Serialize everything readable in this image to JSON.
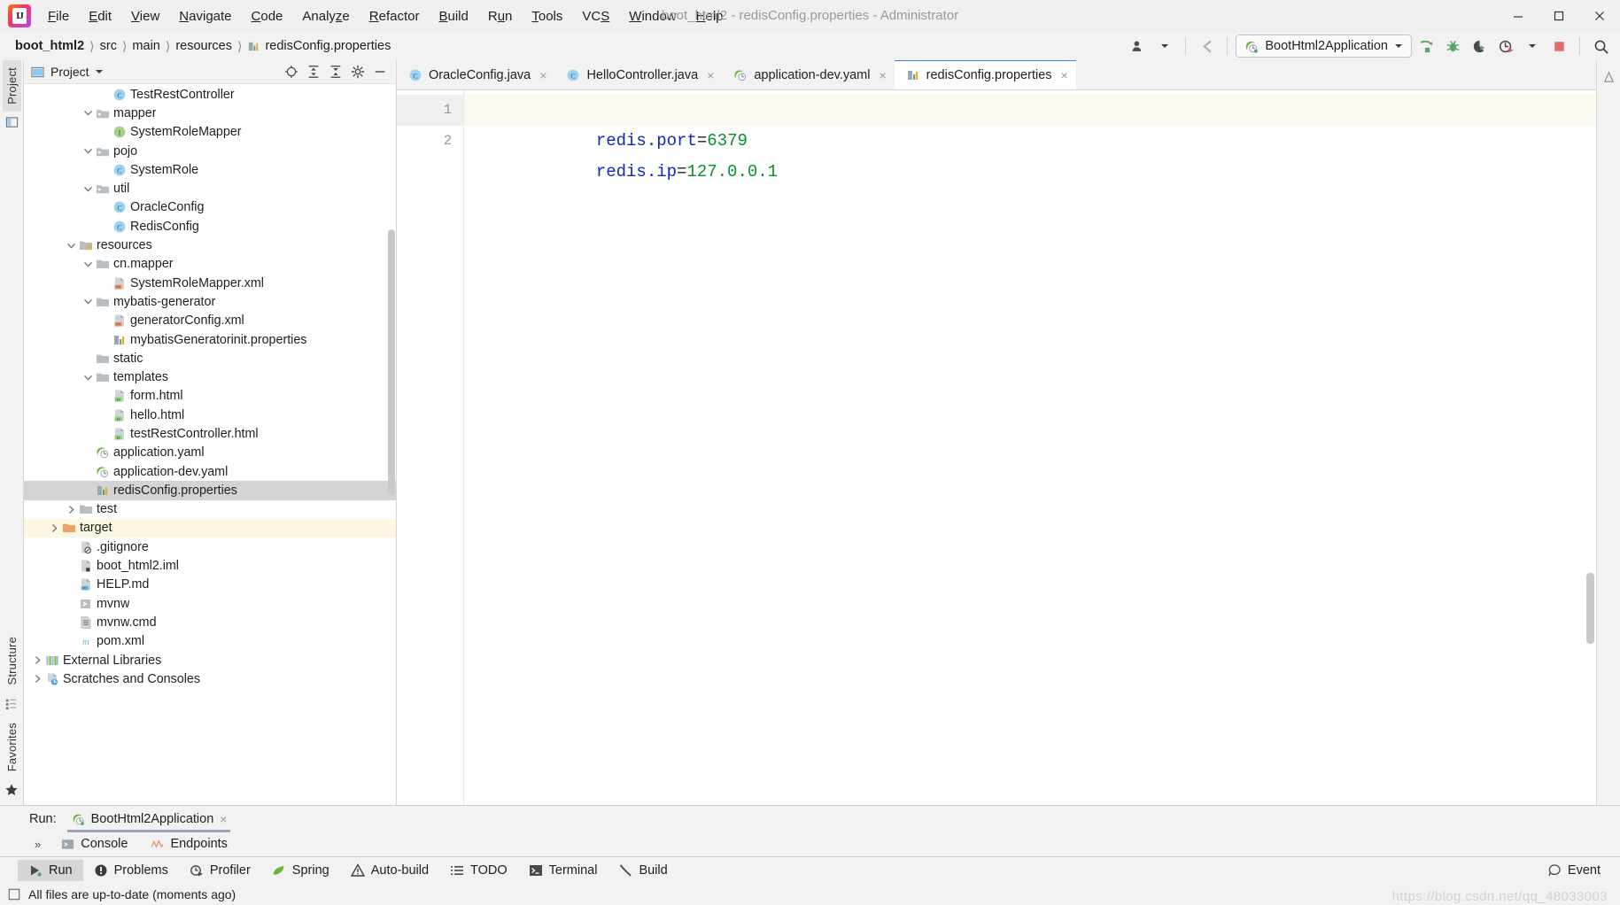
{
  "window": {
    "title": "boot_html2 - redisConfig.properties - Administrator",
    "controls": {
      "minimize": "minimize-icon",
      "maximize": "maximize-icon",
      "close": "close-icon"
    }
  },
  "menubar": {
    "items": [
      {
        "label": "File",
        "mnemonic": "F"
      },
      {
        "label": "Edit",
        "mnemonic": "E"
      },
      {
        "label": "View",
        "mnemonic": "V"
      },
      {
        "label": "Navigate",
        "mnemonic": "N"
      },
      {
        "label": "Code",
        "mnemonic": "C"
      },
      {
        "label": "Analyze",
        "mnemonic": "z"
      },
      {
        "label": "Refactor",
        "mnemonic": "R"
      },
      {
        "label": "Build",
        "mnemonic": "B"
      },
      {
        "label": "Run",
        "mnemonic": "u"
      },
      {
        "label": "Tools",
        "mnemonic": "T"
      },
      {
        "label": "VCS",
        "mnemonic": "S"
      },
      {
        "label": "Window",
        "mnemonic": "W"
      },
      {
        "label": "Help",
        "mnemonic": "H"
      }
    ]
  },
  "navbar": {
    "breadcrumbs": [
      {
        "label": "boot_html2",
        "icon": null
      },
      {
        "label": "src",
        "icon": null
      },
      {
        "label": "main",
        "icon": null
      },
      {
        "label": "resources",
        "icon": null
      },
      {
        "label": "redisConfig.properties",
        "icon": "properties-file-icon"
      }
    ],
    "separator": "〉",
    "right": {
      "user_icon": "user-account-icon",
      "dropdown_icon": "chevron-down-icon",
      "back_icon": "back-arrow-icon",
      "run_config": "BootHtml2Application",
      "run_config_icon": "spring-boot-icon",
      "run_config_chevron": "chevron-down-icon",
      "actions": [
        {
          "name": "run-button",
          "icon": "run-icon"
        },
        {
          "name": "debug-button",
          "icon": "debug-icon"
        },
        {
          "name": "run-with-coverage-button",
          "icon": "coverage-icon"
        },
        {
          "name": "profile-button",
          "icon": "profile-icon"
        },
        {
          "name": "profile-dropdown",
          "icon": "chevron-down-icon"
        },
        {
          "name": "stop-button",
          "icon": "stop-icon"
        },
        {
          "name": "search-everywhere-button",
          "icon": "search-icon"
        }
      ]
    }
  },
  "left_rail": {
    "tabs": [
      {
        "label": "Project",
        "selected": true
      }
    ],
    "bottom_tabs": [
      {
        "label": "Structure"
      },
      {
        "label": "Favorites"
      }
    ]
  },
  "project_panel": {
    "title": "Project",
    "title_icon": "project-view-icon",
    "dropdown_icon": "chevron-down-icon",
    "tools": [
      {
        "name": "scroll-from-source-button",
        "icon": "target-icon"
      },
      {
        "name": "expand-all-button",
        "icon": "expand-all-icon"
      },
      {
        "name": "collapse-all-button",
        "icon": "collapse-all-icon"
      },
      {
        "name": "settings-button",
        "icon": "gear-icon"
      },
      {
        "name": "hide-button",
        "icon": "minus-icon"
      }
    ],
    "tree": [
      {
        "label": "TestRestController",
        "indent": 5,
        "icon": "java-class-icon",
        "twisty": "none",
        "state": "normal"
      },
      {
        "label": "mapper",
        "indent": 4,
        "icon": "package-folder-icon",
        "twisty": "expanded",
        "state": "normal"
      },
      {
        "label": "SystemRoleMapper",
        "indent": 5,
        "icon": "java-interface-icon",
        "twisty": "none",
        "state": "normal"
      },
      {
        "label": "pojo",
        "indent": 4,
        "icon": "package-folder-icon",
        "twisty": "expanded",
        "state": "normal"
      },
      {
        "label": "SystemRole",
        "indent": 5,
        "icon": "java-class-icon",
        "twisty": "none",
        "state": "normal"
      },
      {
        "label": "util",
        "indent": 4,
        "icon": "package-folder-icon",
        "twisty": "expanded",
        "state": "normal"
      },
      {
        "label": "OracleConfig",
        "indent": 5,
        "icon": "java-class-icon",
        "twisty": "none",
        "state": "normal"
      },
      {
        "label": "RedisConfig",
        "indent": 5,
        "icon": "java-class-icon",
        "twisty": "none",
        "state": "normal"
      },
      {
        "label": "resources",
        "indent": 3,
        "icon": "resources-folder-icon",
        "twisty": "expanded",
        "state": "normal"
      },
      {
        "label": "cn.mapper",
        "indent": 4,
        "icon": "folder-icon",
        "twisty": "expanded",
        "state": "normal"
      },
      {
        "label": "SystemRoleMapper.xml",
        "indent": 5,
        "icon": "xml-file-icon",
        "twisty": "none",
        "state": "normal"
      },
      {
        "label": "mybatis-generator",
        "indent": 4,
        "icon": "folder-icon",
        "twisty": "expanded",
        "state": "normal"
      },
      {
        "label": "generatorConfig.xml",
        "indent": 5,
        "icon": "xml-file-icon",
        "twisty": "none",
        "state": "normal"
      },
      {
        "label": "mybatisGeneratorinit.properties",
        "indent": 5,
        "icon": "properties-file-icon",
        "twisty": "none",
        "state": "normal"
      },
      {
        "label": "static",
        "indent": 4,
        "icon": "folder-icon",
        "twisty": "none",
        "state": "normal"
      },
      {
        "label": "templates",
        "indent": 4,
        "icon": "folder-icon",
        "twisty": "expanded",
        "state": "normal"
      },
      {
        "label": "form.html",
        "indent": 5,
        "icon": "html-file-icon",
        "twisty": "none",
        "state": "normal"
      },
      {
        "label": "hello.html",
        "indent": 5,
        "icon": "html-file-icon",
        "twisty": "none",
        "state": "normal"
      },
      {
        "label": "testRestController.html",
        "indent": 5,
        "icon": "html-file-icon",
        "twisty": "none",
        "state": "normal"
      },
      {
        "label": "application.yaml",
        "indent": 4,
        "icon": "spring-yaml-icon",
        "twisty": "none",
        "state": "normal"
      },
      {
        "label": "application-dev.yaml",
        "indent": 4,
        "icon": "spring-yaml-icon",
        "twisty": "none",
        "state": "normal"
      },
      {
        "label": "redisConfig.properties",
        "indent": 4,
        "icon": "properties-file-icon",
        "twisty": "none",
        "state": "selected"
      },
      {
        "label": "test",
        "indent": 3,
        "icon": "folder-icon",
        "twisty": "collapsed",
        "state": "normal"
      },
      {
        "label": "target",
        "indent": 2,
        "icon": "target-folder-icon",
        "twisty": "collapsed",
        "state": "highlighted"
      },
      {
        "label": ".gitignore",
        "indent": 3,
        "icon": "gitignore-file-icon",
        "twisty": "none",
        "state": "normal"
      },
      {
        "label": "boot_html2.iml",
        "indent": 3,
        "icon": "iml-file-icon",
        "twisty": "none",
        "state": "normal"
      },
      {
        "label": "HELP.md",
        "indent": 3,
        "icon": "markdown-file-icon",
        "twisty": "none",
        "state": "normal"
      },
      {
        "label": "mvnw",
        "indent": 3,
        "icon": "shell-script-icon",
        "twisty": "none",
        "state": "normal"
      },
      {
        "label": "mvnw.cmd",
        "indent": 3,
        "icon": "cmd-script-icon",
        "twisty": "none",
        "state": "normal"
      },
      {
        "label": "pom.xml",
        "indent": 3,
        "icon": "maven-pom-icon",
        "twisty": "none",
        "state": "normal"
      },
      {
        "label": "External Libraries",
        "indent": 1,
        "icon": "external-libraries-icon",
        "twisty": "collapsed",
        "state": "normal"
      },
      {
        "label": "Scratches and Consoles",
        "indent": 1,
        "icon": "scratches-icon",
        "twisty": "collapsed",
        "state": "normal"
      }
    ]
  },
  "editor": {
    "tabs": [
      {
        "label": "OracleConfig.java",
        "icon": "java-class-icon",
        "active": false,
        "close": "×"
      },
      {
        "label": "HelloController.java",
        "icon": "java-class-icon",
        "active": false,
        "close": "×"
      },
      {
        "label": "application-dev.yaml",
        "icon": "spring-yaml-icon",
        "active": false,
        "close": "×"
      },
      {
        "label": "redisConfig.properties",
        "icon": "properties-file-icon",
        "active": true,
        "close": "×"
      }
    ],
    "lines": [
      {
        "number": "1",
        "key": "redis.port",
        "eq": "=",
        "value": "6379",
        "current": true
      },
      {
        "number": "2",
        "key": "redis.ip",
        "eq": "=",
        "value": "127.0.0.1",
        "current": false
      }
    ],
    "colors": {
      "key": "#0f28b8",
      "value": "#0a8f2f",
      "operator": "#1f1f1f",
      "current_line_bg": "#fcfaef"
    }
  },
  "run_panel": {
    "label": "Run:",
    "tab": {
      "label": "BootHtml2Application",
      "icon": "spring-boot-icon",
      "close": "×"
    },
    "expand_icon": "»",
    "subtabs": [
      {
        "label": "Console",
        "icon": "console-icon"
      },
      {
        "label": "Endpoints",
        "icon": "endpoints-icon"
      }
    ]
  },
  "bottom_bar": {
    "items": [
      {
        "label": "Run",
        "icon": "run-icon",
        "selected": true
      },
      {
        "label": "Problems",
        "icon": "problems-icon",
        "selected": false
      },
      {
        "label": "Profiler",
        "icon": "profiler-icon",
        "selected": false
      },
      {
        "label": "Spring",
        "icon": "spring-leaf-icon",
        "selected": false
      },
      {
        "label": "Auto-build",
        "icon": "warning-icon",
        "selected": false
      },
      {
        "label": "TODO",
        "icon": "todo-list-icon",
        "selected": false
      },
      {
        "label": "Terminal",
        "icon": "terminal-icon",
        "selected": false
      },
      {
        "label": "Build",
        "icon": "build-hammer-icon",
        "selected": false
      }
    ],
    "right": {
      "label": "Event",
      "icon": "event-log-icon"
    }
  },
  "status_bar": {
    "icon": "checkbox-icon",
    "message": "All files are up-to-date (moments ago)"
  },
  "watermark": "https://blog.csdn.net/qq_48033003",
  "theme": {
    "accent": "#4083c9",
    "panel_bg": "#f2f2f2",
    "editor_bg": "#ffffff",
    "selection_bg": "#d4d4d4",
    "highlight_bg": "#fdf8e3"
  }
}
